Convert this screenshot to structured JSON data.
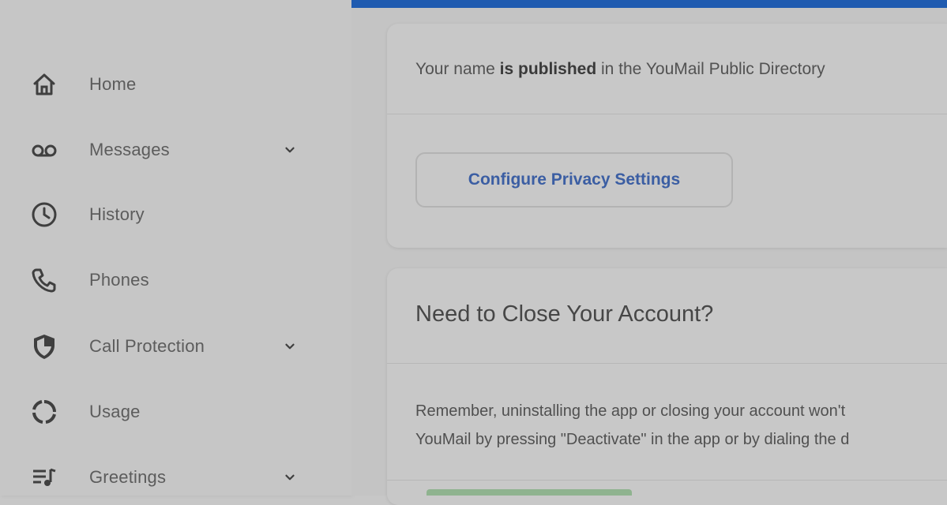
{
  "sidebar": {
    "items": [
      {
        "label": "Home",
        "icon": "home-icon",
        "has_chevron": false
      },
      {
        "label": "Messages",
        "icon": "voicemail-icon",
        "has_chevron": true
      },
      {
        "label": "History",
        "icon": "clock-icon",
        "has_chevron": false
      },
      {
        "label": "Phones",
        "icon": "phone-icon",
        "has_chevron": false
      },
      {
        "label": "Call Protection",
        "icon": "shield-icon",
        "has_chevron": true
      },
      {
        "label": "Usage",
        "icon": "usage-icon",
        "has_chevron": false
      },
      {
        "label": "Greetings",
        "icon": "greetings-icon",
        "has_chevron": true
      }
    ]
  },
  "privacy_card": {
    "status_prefix": "Your name ",
    "status_bold": "is published",
    "status_suffix": " in the YouMail Public Directory",
    "button_label": "Configure Privacy Settings"
  },
  "close_card": {
    "title": "Need to Close Your Account?",
    "line1": "Remember, uninstalling the app or closing your account won't",
    "line2": "YouMail by pressing \"Deactivate\" in the app or by dialing the d"
  },
  "colors": {
    "accent_bar": "#1f5bb0",
    "link_blue": "#3b5ea3"
  }
}
